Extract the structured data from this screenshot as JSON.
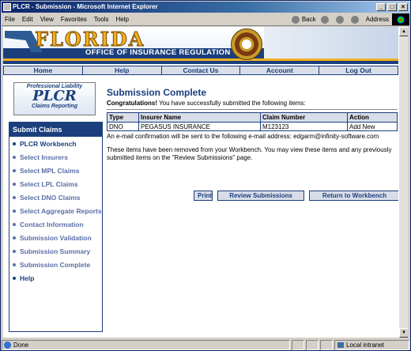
{
  "window": {
    "title": "PLCR - Submission - Microsoft Internet Explorer"
  },
  "menu": {
    "items": [
      "File",
      "Edit",
      "View",
      "Favorites",
      "Tools",
      "Help"
    ],
    "back_label": "Back",
    "address_label": "Address"
  },
  "banner": {
    "state": "FLORIDA",
    "office": "OFFICE OF INSURANCE REGULATION"
  },
  "nav": [
    "Home",
    "Help",
    "Contact Us",
    "Account",
    "Log Out"
  ],
  "logo": {
    "line1": "Professional Liability",
    "line2": "PLCR",
    "line3": "Claims Reporting"
  },
  "sidebar": {
    "header": "Submit Claims",
    "items": [
      {
        "label": "PLCR Workbench"
      },
      {
        "label": "Select Insurers"
      },
      {
        "label": "Select MPL Claims"
      },
      {
        "label": "Select LPL Claims"
      },
      {
        "label": "Select DNO Claims"
      },
      {
        "label": "Select Aggregate Reports"
      },
      {
        "label": "Contact Information"
      },
      {
        "label": "Submission Validation"
      },
      {
        "label": "Submission Summary"
      },
      {
        "label": "Submission Complete"
      },
      {
        "label": "Help"
      }
    ]
  },
  "main": {
    "title": "Submission Complete",
    "congrats_bold": "Congratulations!",
    "congrats_rest": " You have successfully submitted the following items:",
    "table": {
      "headers": [
        "Type",
        "Insurer Name",
        "Claim Number",
        "Action"
      ],
      "rows": [
        [
          "DNO",
          "PEGASUS INSURANCE",
          "M123123",
          "Add New"
        ]
      ]
    },
    "email_note": "An e-mail confirmation will be sent to the following e-mail address: edgarm@infinity-software.com",
    "removed_note": "These items have been removed from your Workbench. You may view these items and any previously submitted items on the \"Review Submissions\" page.",
    "buttons": {
      "print": "Print",
      "review": "Review Submissions",
      "return": "Return to Workbench"
    }
  },
  "status": {
    "text": "Done",
    "zone": "Local intranet"
  }
}
